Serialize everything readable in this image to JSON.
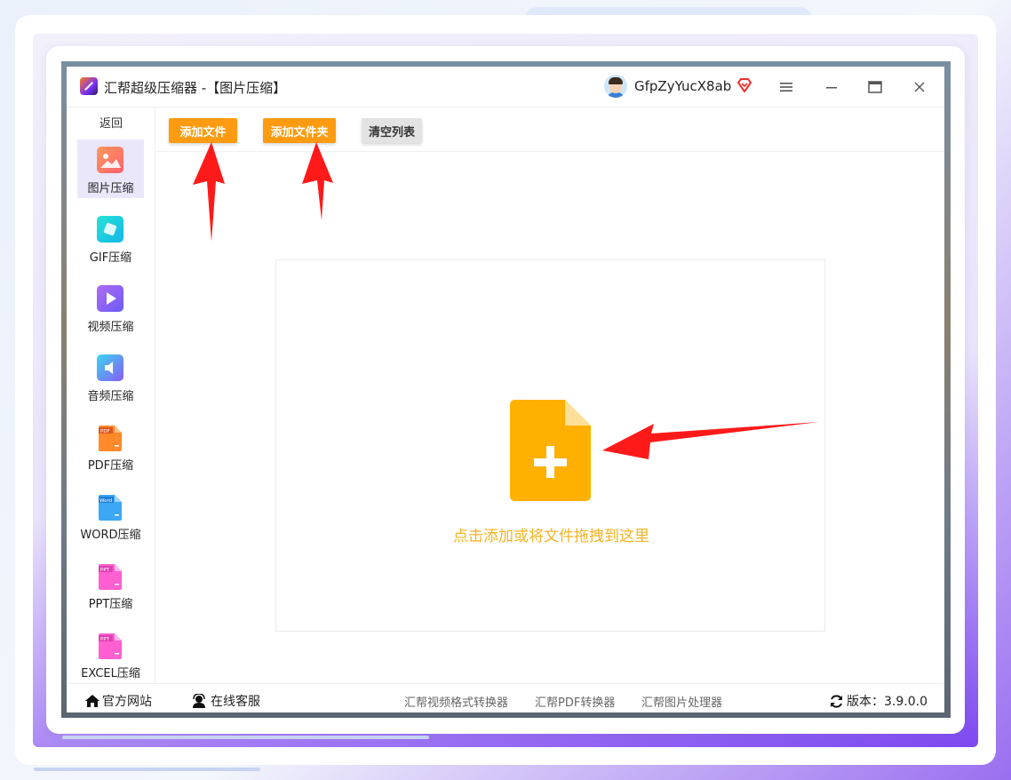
{
  "app": {
    "title": "汇帮超级压缩器  -【图片压缩】",
    "username": "GfpZyYucX8ab"
  },
  "toolbar": {
    "add_file": "添加文件",
    "add_folder": "添加文件夹",
    "clear_list": "清空列表"
  },
  "sidebar": {
    "back": "返回",
    "items": [
      {
        "label": "图片压缩",
        "active": true
      },
      {
        "label": "GIF压缩"
      },
      {
        "label": "视频压缩"
      },
      {
        "label": "音频压缩"
      },
      {
        "label": "PDF压缩"
      },
      {
        "label": "WORD压缩"
      },
      {
        "label": "PPT压缩"
      },
      {
        "label": "EXCEL压缩"
      }
    ]
  },
  "drop_zone": {
    "hint": "点击添加或将文件拖拽到这里"
  },
  "statusbar": {
    "website": "官方网站",
    "support": "在线客服",
    "link_video": "汇帮视频格式转换器",
    "link_pdf": "汇帮PDF转换器",
    "link_image": "汇帮图片处理器",
    "version": "版本：3.9.0.0"
  },
  "icons": {
    "pdf_badge": "PDF",
    "word_badge": "Word",
    "ppt_badge": "PPT",
    "excel_badge": "PPT"
  },
  "colors": {
    "accent_orange": "#fe9b10",
    "file_icon": "#ffb000",
    "hint_text": "#f5b322",
    "annotation_arrow": "#ff1a1a"
  }
}
